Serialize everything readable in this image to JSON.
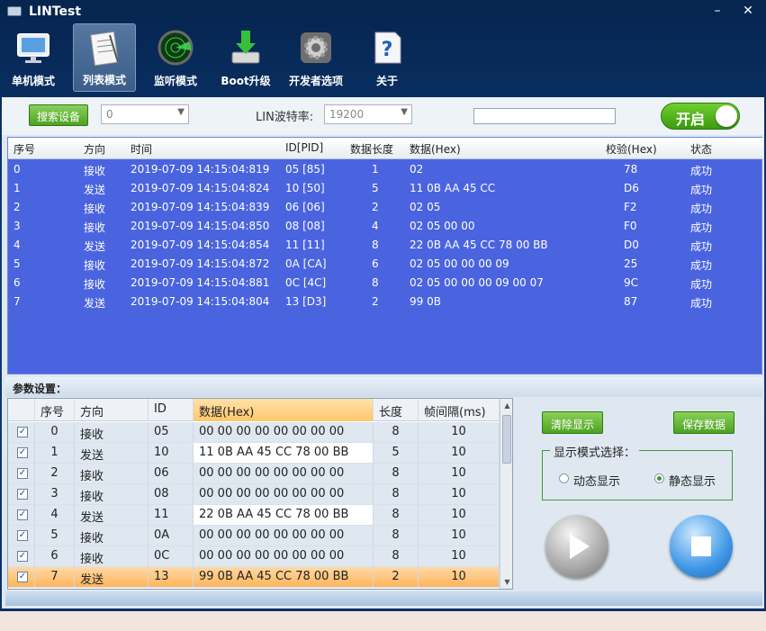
{
  "window": {
    "title": "LINTest",
    "minimize": "–",
    "close": "✕"
  },
  "toolbar": [
    {
      "label": "单机模式",
      "icon": "monitor-icon"
    },
    {
      "label": "列表模式",
      "icon": "notepad-icon",
      "active": true
    },
    {
      "label": "监听模式",
      "icon": "radar-icon"
    },
    {
      "label": "Boot升级",
      "icon": "download-icon"
    },
    {
      "label": "开发者选项",
      "icon": "gear-icon"
    },
    {
      "label": "关于",
      "icon": "help-icon"
    }
  ],
  "controls": {
    "search_button": "搜索设备",
    "device_combo": "0",
    "baud_label": "LIN波特率:",
    "baud_combo": "19200",
    "toggle_label": "开启"
  },
  "log": {
    "headers": [
      "序号",
      "方向",
      "时间",
      "ID[PID]",
      "数据长度",
      "数据(Hex)",
      "校验(Hex)",
      "状态"
    ],
    "rows": [
      [
        "0",
        "接收",
        "2019-07-09 14:15:04:819",
        "05 [85]",
        "1",
        "02",
        "78",
        "成功"
      ],
      [
        "1",
        "发送",
        "2019-07-09 14:15:04:824",
        "10 [50]",
        "5",
        "11 0B AA 45 CC",
        "D6",
        "成功"
      ],
      [
        "2",
        "接收",
        "2019-07-09 14:15:04:839",
        "06 [06]",
        "2",
        "02 05",
        "F2",
        "成功"
      ],
      [
        "3",
        "接收",
        "2019-07-09 14:15:04:850",
        "08 [08]",
        "4",
        "02 05 00 00",
        "F0",
        "成功"
      ],
      [
        "4",
        "发送",
        "2019-07-09 14:15:04:854",
        "11 [11]",
        "8",
        "22 0B AA 45 CC 78 00 BB",
        "D0",
        "成功"
      ],
      [
        "5",
        "接收",
        "2019-07-09 14:15:04:872",
        "0A [CA]",
        "6",
        "02 05 00 00 00 09",
        "25",
        "成功"
      ],
      [
        "6",
        "接收",
        "2019-07-09 14:15:04:881",
        "0C [4C]",
        "8",
        "02 05 00 00 00 09 00 07",
        "9C",
        "成功"
      ],
      [
        "7",
        "发送",
        "2019-07-09 14:15:04:804",
        "13 [D3]",
        "2",
        "99 0B",
        "87",
        "成功"
      ]
    ]
  },
  "params": {
    "title": "参数设置：",
    "headers": [
      "",
      "序号",
      "方向",
      "ID",
      "数据(Hex)",
      "长度",
      "帧间隔(ms)"
    ],
    "rows": [
      {
        "check": "✓",
        "no": "0",
        "dir": "接收",
        "id": "05",
        "data": "00 00 00 00 00 00 00 00",
        "len": "8",
        "interval": "10",
        "editable": false
      },
      {
        "check": "✓",
        "no": "1",
        "dir": "发送",
        "id": "10",
        "data": "11 0B AA 45 CC 78 00 BB",
        "len": "5",
        "interval": "10",
        "editable": true
      },
      {
        "check": "✓",
        "no": "2",
        "dir": "接收",
        "id": "06",
        "data": "00 00 00 00 00 00 00 00",
        "len": "8",
        "interval": "10",
        "editable": false
      },
      {
        "check": "✓",
        "no": "3",
        "dir": "接收",
        "id": "08",
        "data": "00 00 00 00 00 00 00 00",
        "len": "8",
        "interval": "10",
        "editable": false
      },
      {
        "check": "✓",
        "no": "4",
        "dir": "发送",
        "id": "11",
        "data": "22 0B AA 45 CC 78 00 BB",
        "len": "8",
        "interval": "10",
        "editable": true
      },
      {
        "check": "✓",
        "no": "5",
        "dir": "接收",
        "id": "0A",
        "data": "00 00 00 00 00 00 00 00",
        "len": "8",
        "interval": "10",
        "editable": false
      },
      {
        "check": "✓",
        "no": "6",
        "dir": "接收",
        "id": "0C",
        "data": "00 00 00 00 00 00 00 00",
        "len": "8",
        "interval": "10",
        "editable": false
      },
      {
        "check": "✓",
        "no": "7",
        "dir": "发送",
        "id": "13",
        "data": "99 0B AA 45 CC 78 00 BB",
        "len": "2",
        "interval": "10",
        "editable": true,
        "selected": true
      }
    ]
  },
  "side": {
    "clear_button": "清除显示",
    "save_button": "保存数据",
    "mode_title": "显示模式选择：",
    "mode_dynamic": "动态显示",
    "mode_static": "静态显示",
    "selected_mode": "static"
  }
}
